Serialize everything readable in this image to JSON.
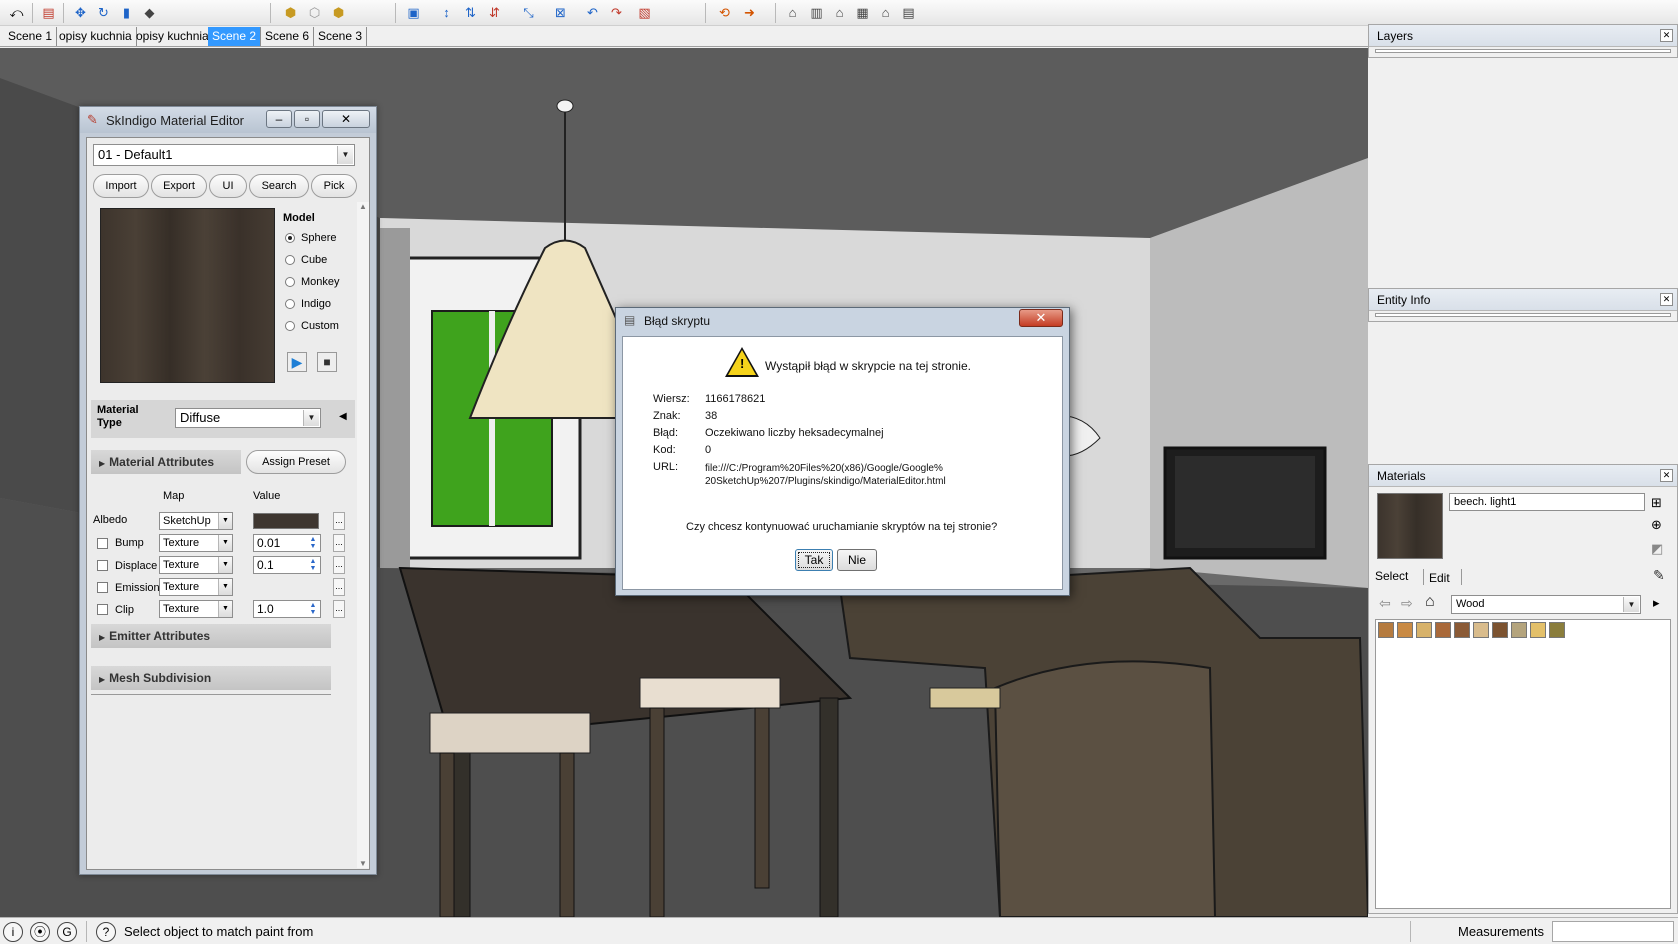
{
  "toolbar": {
    "icons": [
      "select-arrow-icon",
      "paint-bucket-icon",
      "move-icon",
      "rotate-icon",
      "pushpull-icon",
      "paint-icon",
      "iso-view-icon",
      "top-view-icon",
      "front-view-icon",
      "section-icon",
      "axes-icon",
      "guide-icon",
      "dimension-icon",
      "text-icon",
      "orbit-icon",
      "pan-icon",
      "zoom-icon",
      "walk-icon",
      "warehouse-icon",
      "component-icon",
      "house-icon",
      "house2-icon",
      "window-icon"
    ]
  },
  "scenes": {
    "tabs": [
      "Scene 1",
      "opisy kuchnia",
      "opisy kuchnia",
      "Scene 2",
      "Scene 6",
      "Scene 3"
    ],
    "active_index": 3
  },
  "editor": {
    "title": "SkIndigo Material Editor",
    "material_select": "01 - Default1",
    "buttons": {
      "import": "Import",
      "export": "Export",
      "ui": "UI",
      "search": "Search",
      "pick": "Pick"
    },
    "model_heading": "Model",
    "model_options": [
      "Sphere",
      "Cube",
      "Monkey",
      "Indigo",
      "Custom"
    ],
    "model_selected": "Sphere",
    "material_type_label": "Material Type",
    "material_type_value": "Diffuse",
    "material_attributes": "Material Attributes",
    "assign_preset": "Assign Preset",
    "col_map": "Map",
    "col_value": "Value",
    "albedo_label": "Albedo",
    "albedo_map": "SketchUp",
    "albedo_color": "#3e3630",
    "bump_label": "Bump",
    "bump_map": "Texture",
    "bump_value": "0.01",
    "displace_label": "Displace",
    "displace_map": "Texture",
    "displace_value": "0.1",
    "emission_label": "Emission",
    "emission_map": "Texture",
    "clip_label": "Clip",
    "clip_map": "Texture",
    "clip_value": "1.0",
    "dots": "...",
    "emitter_attributes": "Emitter Attributes",
    "mesh_subdivision": "Mesh Subdivision"
  },
  "layers": {
    "title": "Layers"
  },
  "entity_info": {
    "title": "Entity Info"
  },
  "materials": {
    "title": "Materials",
    "name_value": "beech. light1",
    "tab_select": "Select",
    "tab_edit": "Edit",
    "library": "Wood",
    "swatches": [
      "#b57b3f",
      "#c98a44",
      "#d7b26a",
      "#a9693a",
      "#8a5a36",
      "#d9bc8c",
      "#7c5330",
      "#b4a47d",
      "#e3c06a",
      "#8a7d3c"
    ]
  },
  "dialog": {
    "title": "Błąd skryptu",
    "message": "Wystąpił błąd w skrypcie na tej stronie.",
    "row_labels": [
      "Wiersz:",
      "Znak:",
      "Błąd:",
      "Kod:",
      "URL:"
    ],
    "row_values": [
      "1166178621",
      "38",
      "Oczekiwano liczby heksadecymalnej",
      "0"
    ],
    "url_line1": "file:///C:/Program%20Files%20(x86)/Google/Google%",
    "url_line2": "20SketchUp%207/Plugins/skindigo/MaterialEditor.html",
    "question": "Czy chcesz kontynuować uruchamianie skryptów na tej stronie?",
    "yes": "Tak",
    "no": "Nie"
  },
  "status": {
    "text": "Select object to match paint from",
    "measurements": "Measurements"
  }
}
